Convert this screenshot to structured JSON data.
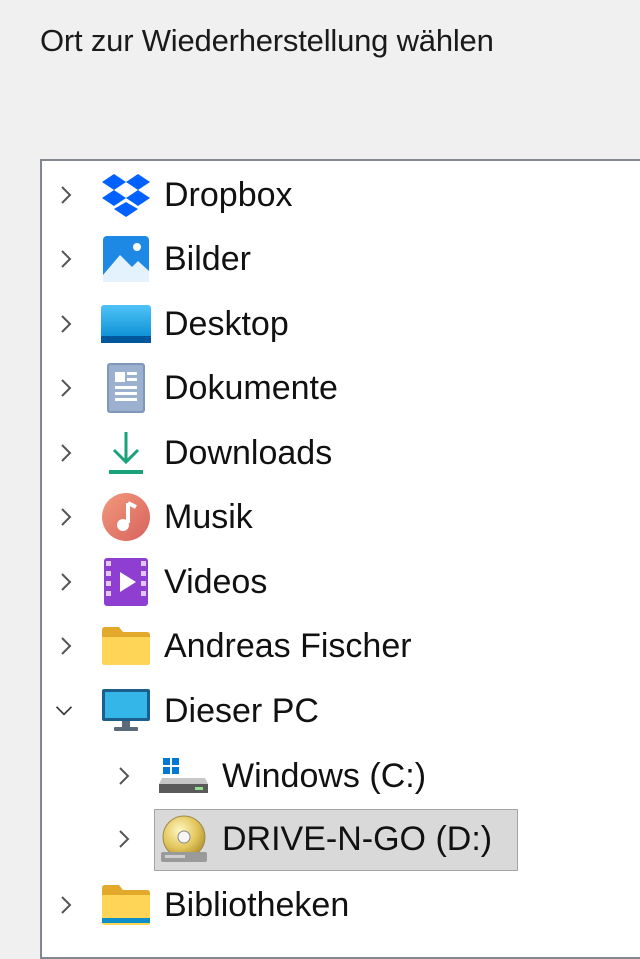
{
  "dialog": {
    "title": "Ort zur Wiederherstellung wählen"
  },
  "tree": {
    "items": [
      {
        "label": "Dropbox",
        "icon": "dropbox-icon",
        "level": 0,
        "expanded": false
      },
      {
        "label": "Bilder",
        "icon": "pictures-icon",
        "level": 0,
        "expanded": false
      },
      {
        "label": "Desktop",
        "icon": "desktop-icon",
        "level": 0,
        "expanded": false
      },
      {
        "label": "Dokumente",
        "icon": "documents-icon",
        "level": 0,
        "expanded": false
      },
      {
        "label": "Downloads",
        "icon": "downloads-icon",
        "level": 0,
        "expanded": false
      },
      {
        "label": "Musik",
        "icon": "music-icon",
        "level": 0,
        "expanded": false
      },
      {
        "label": "Videos",
        "icon": "videos-icon",
        "level": 0,
        "expanded": false
      },
      {
        "label": "Andreas Fischer",
        "icon": "folder-icon",
        "level": 0,
        "expanded": false
      },
      {
        "label": "Dieser PC",
        "icon": "this-pc-icon",
        "level": 0,
        "expanded": true
      },
      {
        "label": "Windows (C:)",
        "icon": "system-drive-icon",
        "level": 1,
        "expanded": false
      },
      {
        "label": "DRIVE-N-GO (D:)",
        "icon": "cd-drive-icon",
        "level": 1,
        "expanded": false,
        "selected": true
      },
      {
        "label": "Bibliotheken",
        "icon": "libraries-icon",
        "level": 0,
        "expanded": false
      }
    ]
  }
}
